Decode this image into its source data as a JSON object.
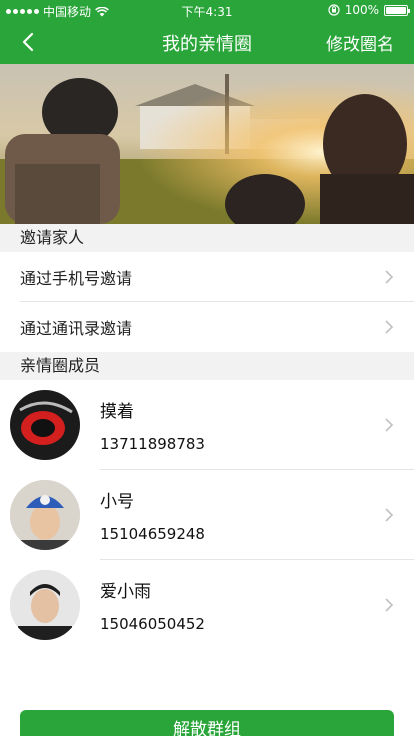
{
  "status_bar": {
    "carrier": "中国移动",
    "time": "下午4:31",
    "battery": "100%",
    "battery_level": 1.0
  },
  "nav": {
    "title": "我的亲情圈",
    "right_action": "修改圈名"
  },
  "invite_section": {
    "header": "邀请家人",
    "items": [
      {
        "label": "通过手机号邀请"
      },
      {
        "label": "通过通讯录邀请"
      }
    ]
  },
  "members_section": {
    "header": "亲情圈成员",
    "members": [
      {
        "name": "摸着",
        "phone": "13711898783"
      },
      {
        "name": "小号",
        "phone": "15104659248"
      },
      {
        "name": "爱小雨",
        "phone": "15046050452"
      }
    ]
  },
  "actions": {
    "dissolve_label": "解散群组"
  },
  "colors": {
    "brand_green": "#2aa53a",
    "section_bg": "#f2f2f2",
    "divider": "#e5e5e5"
  }
}
